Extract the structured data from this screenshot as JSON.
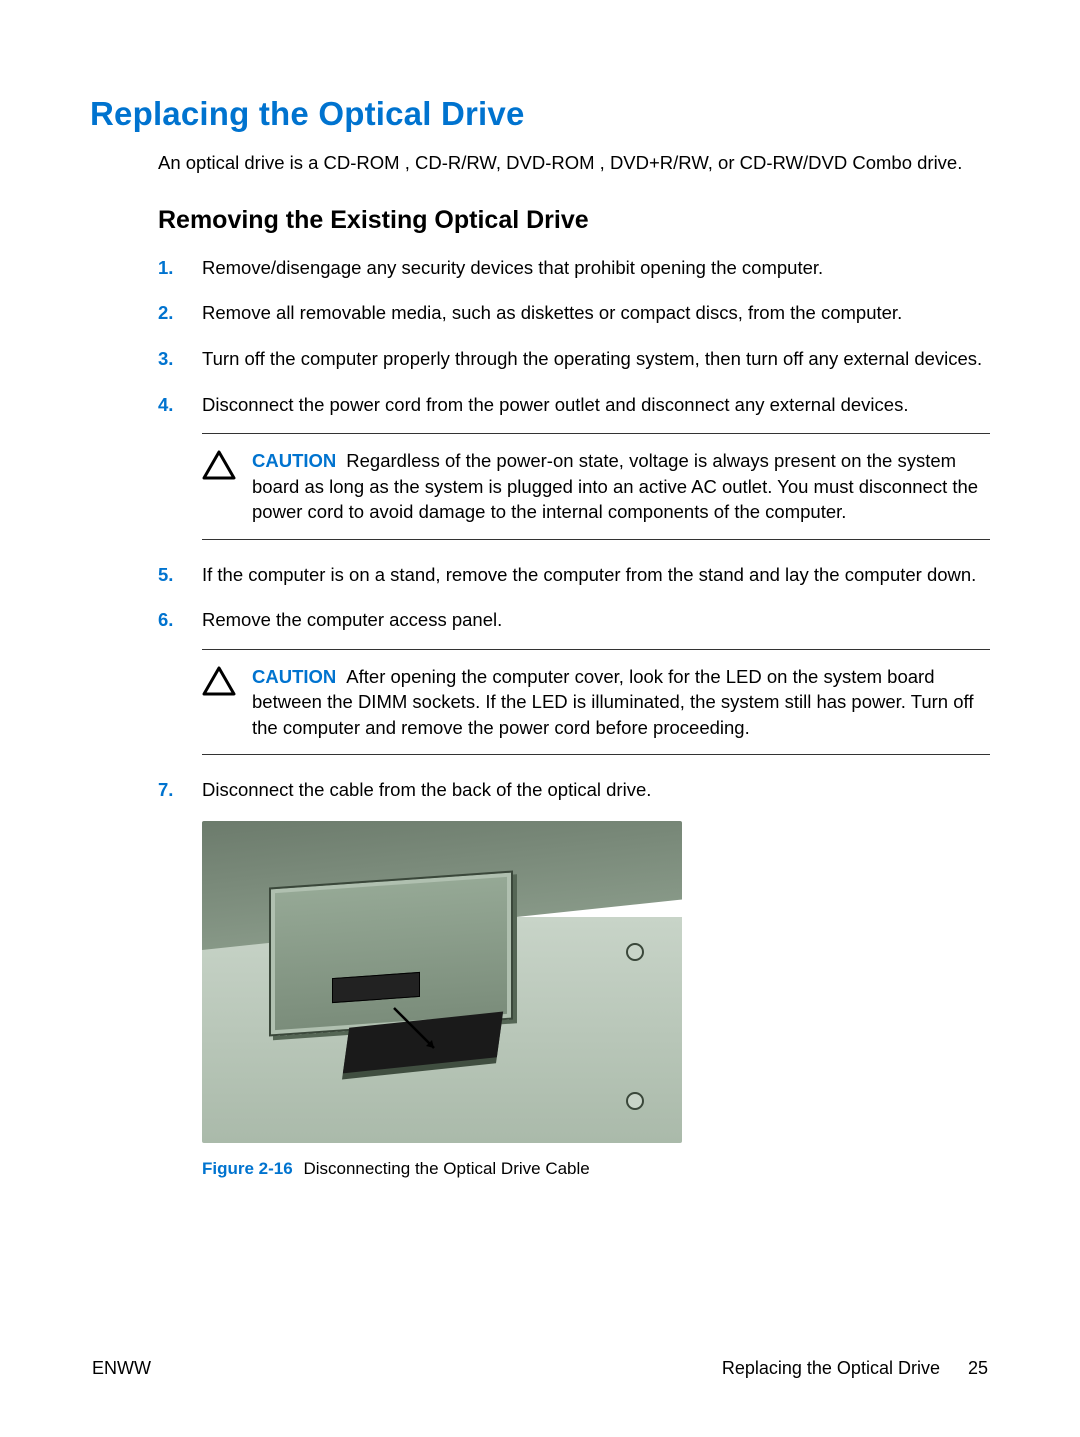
{
  "title": "Replacing the Optical Drive",
  "intro": "An optical drive is a CD-ROM , CD-R/RW, DVD-ROM , DVD+R/RW, or CD-RW/DVD Combo drive.",
  "subtitle": "Removing the Existing Optical Drive",
  "steps": [
    "Remove/disengage any security devices that prohibit opening the computer.",
    "Remove all removable media, such as diskettes or compact discs, from the computer.",
    "Turn off the computer properly through the operating system, then turn off any external devices.",
    "Disconnect the power cord from the power outlet and disconnect any external devices.",
    "If the computer is on a stand, remove the computer from the stand and lay the computer down.",
    "Remove the computer access panel.",
    "Disconnect the cable from the back of the optical drive."
  ],
  "caution_label": "CAUTION",
  "caution1": "Regardless of the power-on state, voltage is always present on the system board as long as the system is plugged into an active AC outlet. You must disconnect the power cord to avoid damage to the internal components of the computer.",
  "caution2": "After opening the computer cover, look for the LED on the system board between the DIMM sockets. If the LED is illuminated, the system still has power. Turn off the computer and remove the power cord before proceeding.",
  "figure": {
    "label": "Figure 2-16",
    "caption": "Disconnecting the Optical Drive Cable"
  },
  "footer": {
    "left": "ENWW",
    "right_text": "Replacing the Optical Drive",
    "page": "25"
  }
}
